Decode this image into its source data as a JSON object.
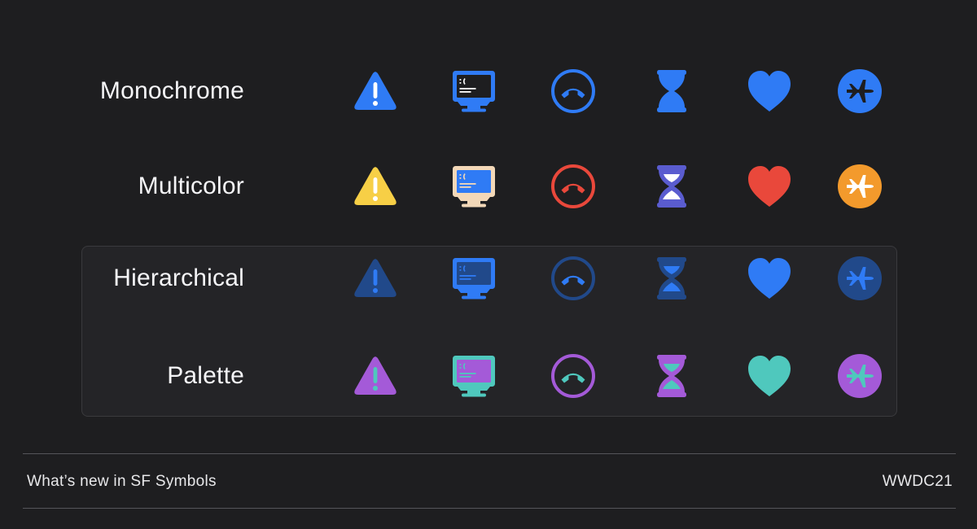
{
  "rows": [
    {
      "label": "Monochrome",
      "colors": {
        "warning": {
          "primary": "#2f7bf5",
          "secondary": "#ffffff"
        },
        "computer": {
          "primary": "#2f7bf5",
          "secondary": "#2f7bf5",
          "screen": "#1e1e20"
        },
        "phone": {
          "primary": "#2f7bf5",
          "secondary": "#2f7bf5"
        },
        "hourglass": {
          "primary": "#2f7bf5",
          "secondary": "#2f7bf5"
        },
        "heart": {
          "primary": "#2f7bf5"
        },
        "airplane": {
          "primary": "#2f7bf5",
          "secondary": "#1e1e20"
        }
      }
    },
    {
      "label": "Multicolor",
      "colors": {
        "warning": {
          "primary": "#f7cf46",
          "secondary": "#ffffff"
        },
        "computer": {
          "primary": "#f3d8b8",
          "secondary": "#2f7bf5",
          "screen": "#2f7bf5"
        },
        "phone": {
          "primary": "#e9483b",
          "secondary": "#e9483b"
        },
        "hourglass": {
          "primary": "#5a5ccf",
          "secondary": "#ffffff"
        },
        "heart": {
          "primary": "#e9483b"
        },
        "airplane": {
          "primary": "#f39a2c",
          "secondary": "#ffffff"
        }
      }
    },
    {
      "label": "Hierarchical",
      "colors": {
        "warning": {
          "primary": "#21498a",
          "secondary": "#2f7bf5"
        },
        "computer": {
          "primary": "#2f7bf5",
          "secondary": "#21498a",
          "screen": "#21498a"
        },
        "phone": {
          "primary": "#21498a",
          "secondary": "#2f7bf5"
        },
        "hourglass": {
          "primary": "#21498a",
          "secondary": "#2f7bf5"
        },
        "heart": {
          "primary": "#2f7bf5"
        },
        "airplane": {
          "primary": "#21498a",
          "secondary": "#2f7bf5"
        }
      }
    },
    {
      "label": "Palette",
      "colors": {
        "warning": {
          "primary": "#a45ad8",
          "secondary": "#4fc8bd"
        },
        "computer": {
          "primary": "#4fc8bd",
          "secondary": "#a45ad8",
          "screen": "#a45ad8"
        },
        "phone": {
          "primary": "#a45ad8",
          "secondary": "#4fc8bd"
        },
        "hourglass": {
          "primary": "#a45ad8",
          "secondary": "#4fc8bd"
        },
        "heart": {
          "primary": "#4fc8bd"
        },
        "airplane": {
          "primary": "#a45ad8",
          "secondary": "#4fc8bd"
        }
      }
    }
  ],
  "symbols": [
    "warning-icon",
    "computer-icon",
    "phone-down-icon",
    "hourglass-icon",
    "heart-icon",
    "airplane-icon"
  ],
  "footer": {
    "title": "What’s new in SF Symbols",
    "event": "WWDC21"
  }
}
